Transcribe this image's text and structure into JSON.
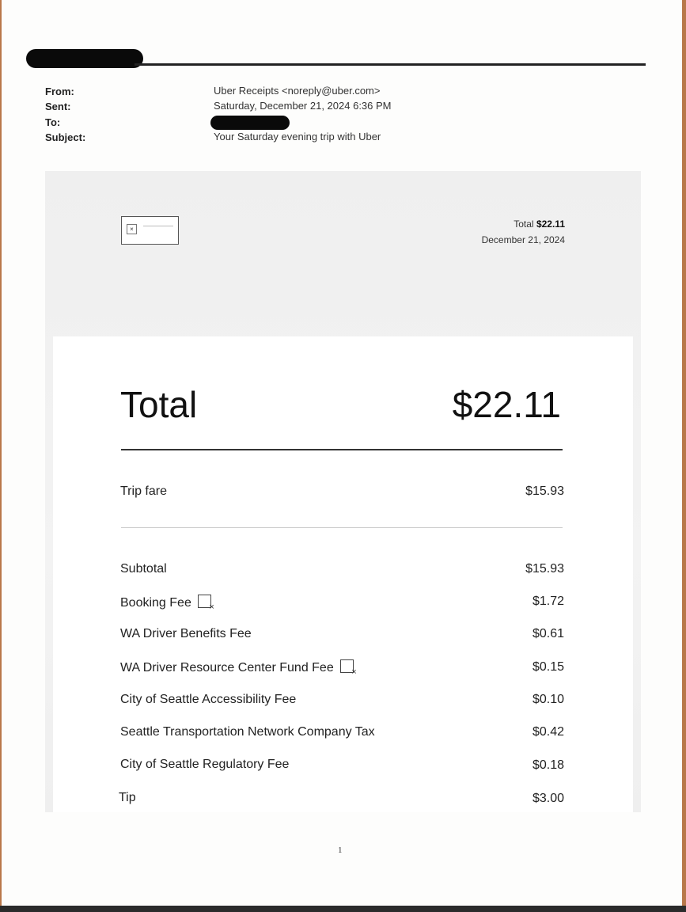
{
  "email_header": {
    "from_label": "From:",
    "from_value": "Uber Receipts <noreply@uber.com>",
    "sent_label": "Sent:",
    "sent_value": "Saturday, December 21, 2024 6:36 PM",
    "to_label": "To:",
    "subject_label": "Subject:",
    "subject_value": "Your Saturday evening trip with Uber"
  },
  "banner": {
    "total_prefix": "Total",
    "total_amount": "$22.11",
    "date": "December 21, 2024",
    "broken_image_icon": "broken-image-icon"
  },
  "receipt": {
    "total_label": "Total",
    "total_amount": "$22.11",
    "trip_fare_label": "Trip fare",
    "trip_fare_amount": "$15.93",
    "line_items": [
      {
        "label": "Subtotal",
        "amount": "$15.93",
        "info_icon": false
      },
      {
        "label": "Booking Fee",
        "amount": "$1.72",
        "info_icon": true
      },
      {
        "label": "WA Driver Benefits Fee",
        "amount": "$0.61",
        "info_icon": false
      },
      {
        "label": "WA Driver Resource Center Fund Fee",
        "amount": "$0.15",
        "info_icon": true
      },
      {
        "label": "City of Seattle Accessibility Fee",
        "amount": "$0.10",
        "info_icon": false
      },
      {
        "label": "Seattle Transportation Network Company Tax",
        "amount": "$0.42",
        "info_icon": false
      },
      {
        "label": "City of Seattle Regulatory Fee",
        "amount": "$0.18",
        "info_icon": false
      },
      {
        "label": "Tip",
        "amount": "$3.00",
        "info_icon": false
      }
    ]
  },
  "footer": {
    "page_number": "1"
  }
}
